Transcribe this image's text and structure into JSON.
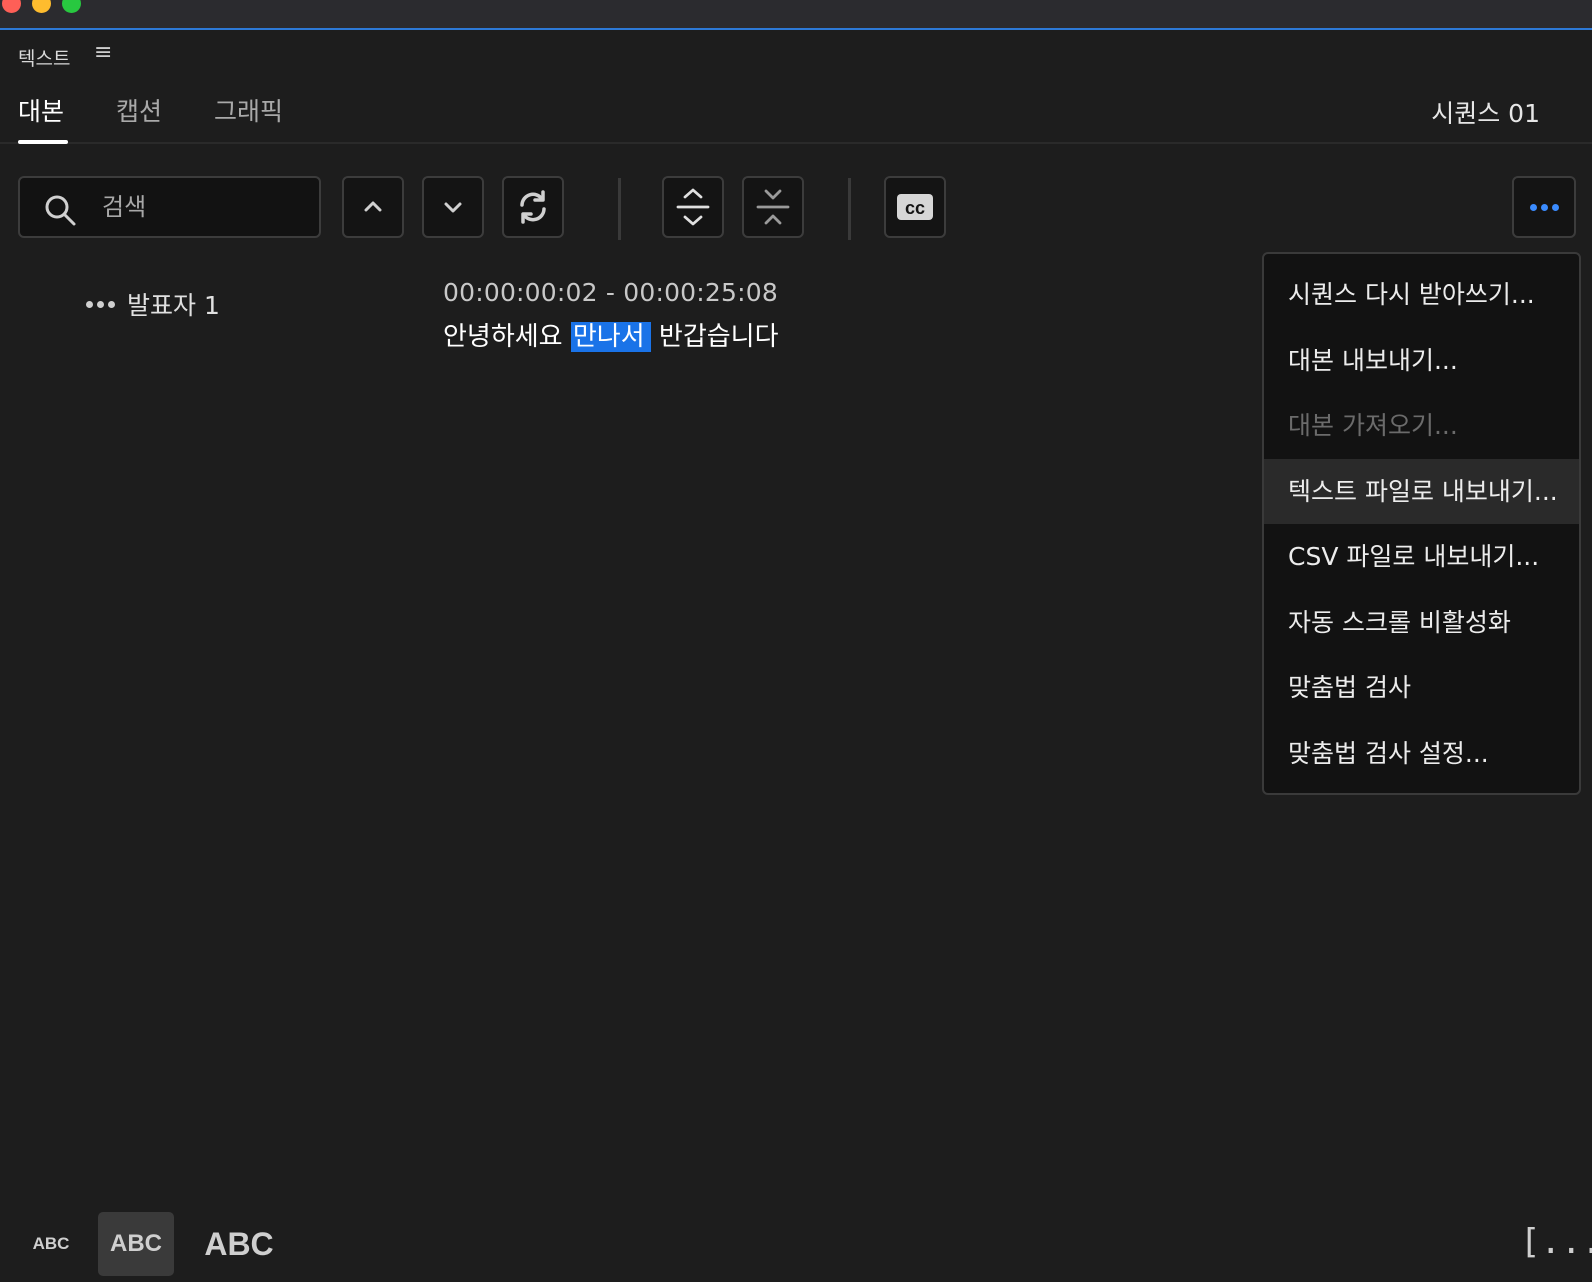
{
  "panel": {
    "title": "텍스트"
  },
  "tabs": [
    {
      "label": "대본"
    },
    {
      "label": "캡션"
    },
    {
      "label": "그래픽"
    }
  ],
  "sequence_label": "시퀀스 01",
  "search": {
    "placeholder": "검색"
  },
  "toolbar": {
    "icons": [
      "search-icon",
      "chevron-up-icon",
      "chevron-down-icon",
      "refresh-icon",
      "expand-icon",
      "collapse-icon",
      "closed-caption-icon",
      "more-options-icon"
    ]
  },
  "transcript": {
    "speaker": "발표자 1",
    "timecode": "00:00:00:02 - 00:00:25:08",
    "text_before": "안녕하세요 ",
    "text_selected": "만나서",
    "text_after": " 반갑습니다"
  },
  "menu": {
    "items": [
      {
        "label": "시퀀스 다시 받아쓰기...",
        "state": "enabled"
      },
      {
        "label": "대본 내보내기...",
        "state": "enabled"
      },
      {
        "label": "대본 가져오기...",
        "state": "disabled"
      },
      {
        "label": "텍스트 파일로 내보내기...",
        "state": "hover"
      },
      {
        "label": "CSV 파일로 내보내기...",
        "state": "enabled"
      },
      {
        "label": "자동 스크롤 비활성화",
        "state": "enabled"
      },
      {
        "label": "맞춤법 검사",
        "state": "enabled"
      },
      {
        "label": "맞춤법 검사 설정...",
        "state": "enabled"
      }
    ]
  },
  "font_size": {
    "small": "ABC",
    "medium": "ABC",
    "large": "ABC",
    "selected": "medium"
  },
  "bracket_label": "[...]",
  "colors": {
    "accent": "#1a73e8",
    "background": "#1d1d1d",
    "menu_bg": "#121212"
  }
}
